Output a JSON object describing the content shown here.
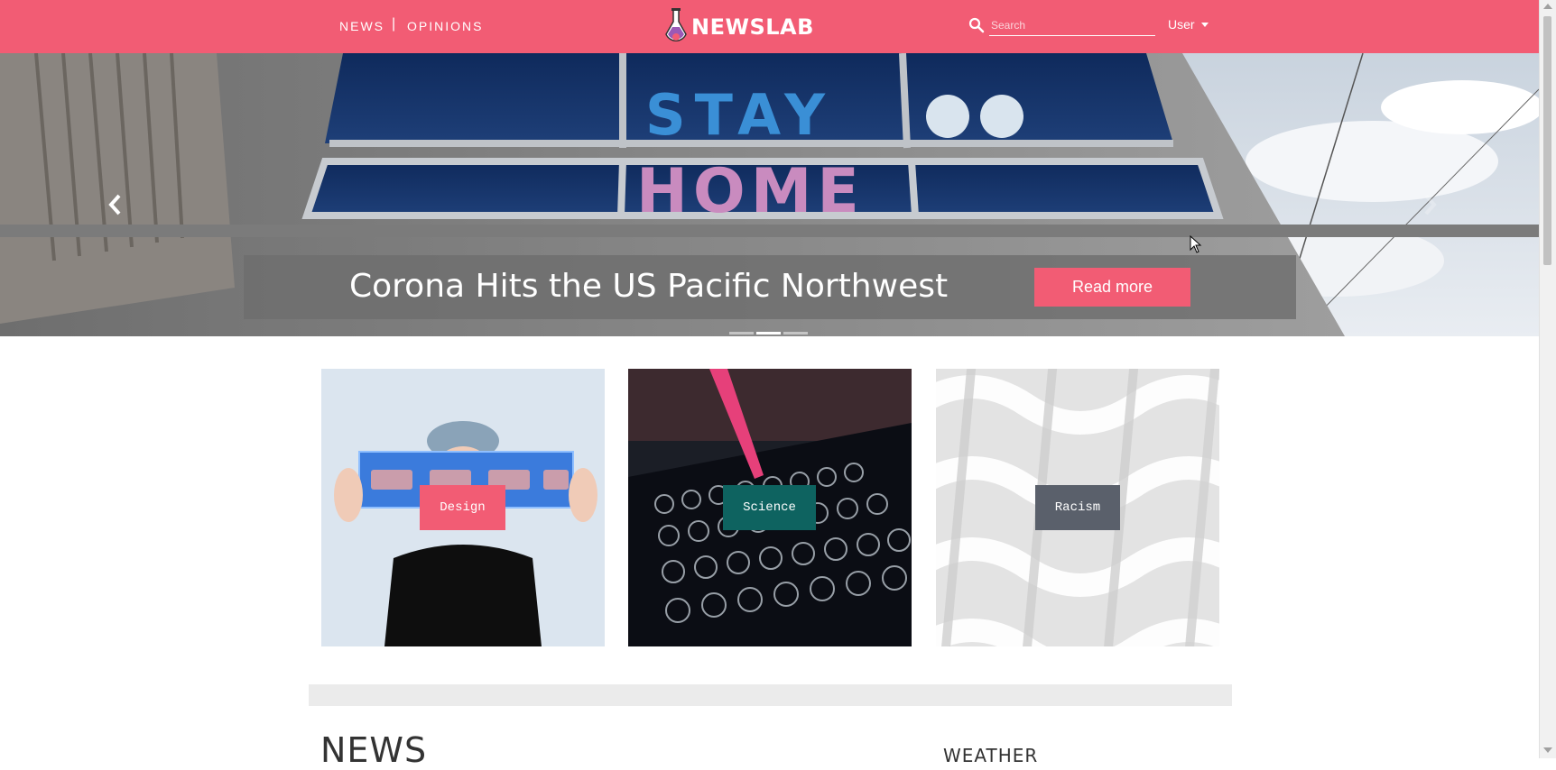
{
  "navbar": {
    "links": [
      {
        "label": "NEWS"
      },
      {
        "label": "OPINIONS"
      }
    ],
    "separator": "|",
    "logo_text": "NEWSLAB",
    "search_placeholder": "Search",
    "user_label": "User",
    "background_color": "#f25c74"
  },
  "hero": {
    "sign_text_top": "STAY",
    "sign_text_bottom": "HOME",
    "caption": "Corona Hits the US Pacific Northwest",
    "button_label": "Read more",
    "indicator_count": 3,
    "active_indicator": 2
  },
  "categories": [
    {
      "label": "Design",
      "color": "#f25c74"
    },
    {
      "label": "Science",
      "color": "#0e6360"
    },
    {
      "label": "Racism",
      "color": "#5a606b"
    }
  ],
  "sections": {
    "news": "NEWS",
    "weather": "WEATHER"
  },
  "icons": {
    "search": "search-icon",
    "prev": "chevron-left-icon",
    "next": "chevron-right-icon",
    "flask": "flask-icon"
  }
}
